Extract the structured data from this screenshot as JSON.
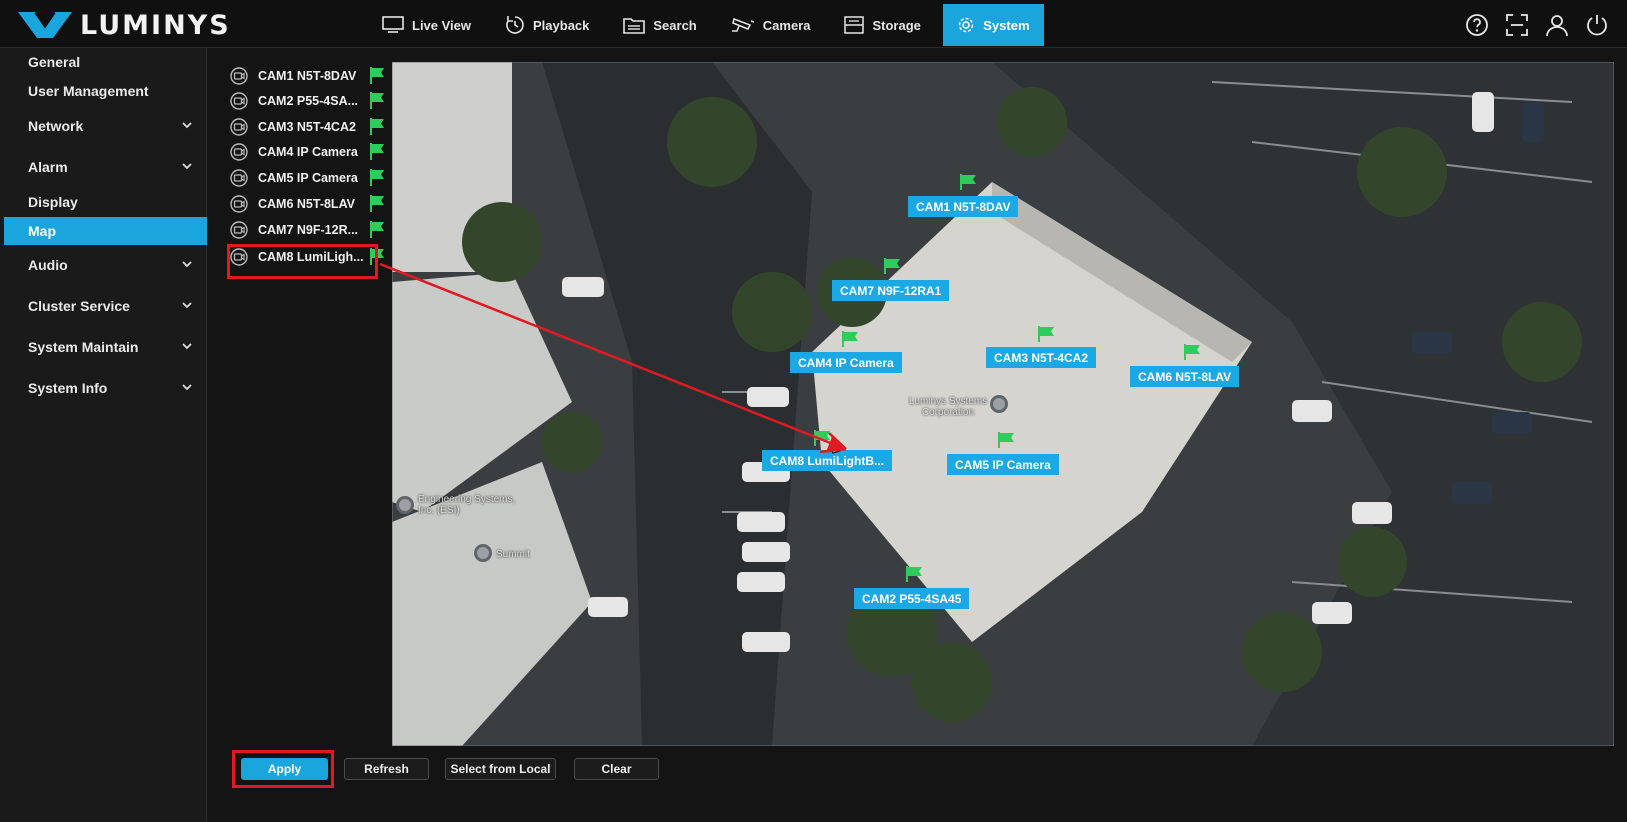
{
  "brand": {
    "name": "LUMINYS"
  },
  "nav": [
    {
      "label": "Live View",
      "icon": "monitor-icon"
    },
    {
      "label": "Playback",
      "icon": "playback-icon"
    },
    {
      "label": "Search",
      "icon": "folder-search-icon"
    },
    {
      "label": "Camera",
      "icon": "camera-icon"
    },
    {
      "label": "Storage",
      "icon": "storage-icon"
    },
    {
      "label": "System",
      "icon": "gear-icon",
      "active": true
    }
  ],
  "top_icons": [
    "help-icon",
    "fullscreen-icon",
    "user-icon",
    "power-icon"
  ],
  "sidebar": {
    "items": [
      {
        "label": "General"
      },
      {
        "label": "User Management"
      },
      {
        "label": "Network",
        "expandable": true
      },
      {
        "label": "Alarm",
        "expandable": true
      },
      {
        "label": "Display"
      },
      {
        "label": "Map",
        "active": true
      },
      {
        "label": "Audio",
        "expandable": true
      },
      {
        "label": "Cluster Service",
        "expandable": true
      },
      {
        "label": "System Maintain",
        "expandable": true
      },
      {
        "label": "System Info",
        "expandable": true
      }
    ]
  },
  "cameras": [
    {
      "label": "CAM1 N5T-8DAV"
    },
    {
      "label": "CAM2 P55-4SA..."
    },
    {
      "label": "CAM3 N5T-4CA2"
    },
    {
      "label": "CAM4 IP Camera"
    },
    {
      "label": "CAM5 IP Camera"
    },
    {
      "label": "CAM6 N5T-8LAV"
    },
    {
      "label": "CAM7 N9F-12R..."
    },
    {
      "label": "CAM8 LumiLigh..."
    }
  ],
  "map": {
    "markers": [
      {
        "label": "CAM1 N5T-8DAV"
      },
      {
        "label": "CAM7 N9F-12RA1"
      },
      {
        "label": "CAM4 IP Camera"
      },
      {
        "label": "CAM3 N5T-4CA2"
      },
      {
        "label": "CAM6 N5T-8LAV"
      },
      {
        "label": "CAM8 LumiLightB..."
      },
      {
        "label": "CAM5 IP Camera"
      },
      {
        "label": "CAM2 P55-4SA45"
      }
    ],
    "places": [
      {
        "label": "Luminys Systems Corporation"
      },
      {
        "label": "Engineering Systems, Inc. (ESI)"
      },
      {
        "label": "Summit"
      }
    ]
  },
  "buttons": {
    "apply": "Apply",
    "refresh": "Refresh",
    "select_local": "Select from Local",
    "clear": "Clear"
  },
  "colors": {
    "accent": "#1aa5dd",
    "flag": "#2ecc5a",
    "highlight": "#e01a22"
  }
}
